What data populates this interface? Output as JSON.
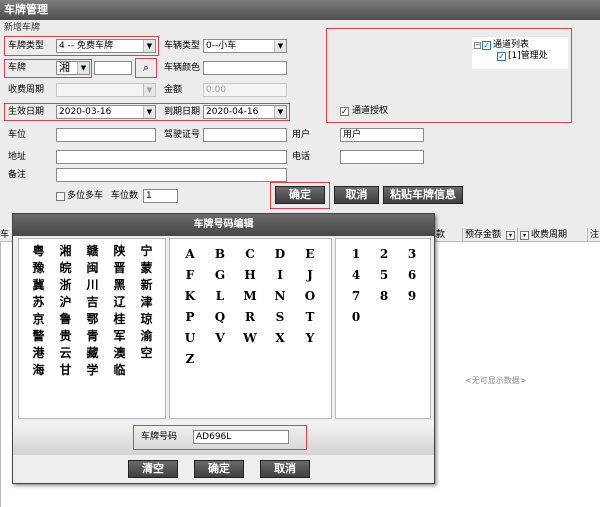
{
  "window": {
    "title": "车牌管理"
  },
  "section": {
    "title": "新增车牌"
  },
  "form": {
    "plate_type": {
      "label": "车牌类型",
      "value": "4 -- 免费车牌"
    },
    "vehicle_type": {
      "label": "车辆类型",
      "value": "0--小车"
    },
    "plate": {
      "label": "车牌",
      "province": "湘",
      "number": ""
    },
    "vehicle_color": {
      "label": "车辆颜色",
      "value": ""
    },
    "charge_period": {
      "label": "收费周期",
      "value": ""
    },
    "amount": {
      "label": "金额",
      "value": "0.00"
    },
    "start_date": {
      "label": "生效日期",
      "value": "2020-03-16"
    },
    "end_date": {
      "label": "到期日期",
      "value": "2020-04-16"
    },
    "channel_auth": {
      "label": "通道授权",
      "checked": true
    },
    "space": {
      "label": "车位",
      "value": ""
    },
    "license": {
      "label": "驾驶证号",
      "value": ""
    },
    "user": {
      "label": "用户",
      "value": "用户"
    },
    "address": {
      "label": "地址",
      "value": ""
    },
    "phone": {
      "label": "电话",
      "value": ""
    },
    "remark": {
      "label": "备注",
      "value": ""
    },
    "multi_space": {
      "label": "多位多车",
      "checked": false
    },
    "space_count": {
      "label": "车位数",
      "value": "1"
    }
  },
  "tree": {
    "root": "通道列表",
    "child": "[1]管理处"
  },
  "buttons": {
    "confirm": "确定",
    "cancel": "取消",
    "paste": "粘贴车牌信息"
  },
  "grid": {
    "columns": [
      "预存金额",
      "收费周期",
      "注"
    ],
    "empty": "<无可显示数据>"
  },
  "dialog": {
    "title": "车牌号码编辑",
    "provinces": [
      "粤",
      "湘",
      "赣",
      "陕",
      "宁",
      "豫",
      "皖",
      "闽",
      "晋",
      "蒙",
      "冀",
      "浙",
      "川",
      "黑",
      "新",
      "苏",
      "沪",
      "吉",
      "辽",
      "津",
      "京",
      "鲁",
      "鄂",
      "桂",
      "琼",
      "警",
      "贵",
      "青",
      "军",
      "渝",
      "港",
      "云",
      "藏",
      "澳",
      "空",
      "海",
      "甘",
      "学",
      "临"
    ],
    "letters": [
      "A",
      "B",
      "C",
      "D",
      "E",
      "F",
      "G",
      "H",
      "I",
      "J",
      "K",
      "L",
      "M",
      "N",
      "O",
      "P",
      "Q",
      "R",
      "S",
      "T",
      "U",
      "V",
      "W",
      "X",
      "Y",
      "Z"
    ],
    "digits": [
      "1",
      "2",
      "3",
      "4",
      "5",
      "6",
      "7",
      "8",
      "9",
      "0"
    ],
    "plate_label": "车牌号码",
    "plate_value": "AD696L",
    "clear": "清空",
    "confirm": "确定",
    "cancel": "取消"
  }
}
